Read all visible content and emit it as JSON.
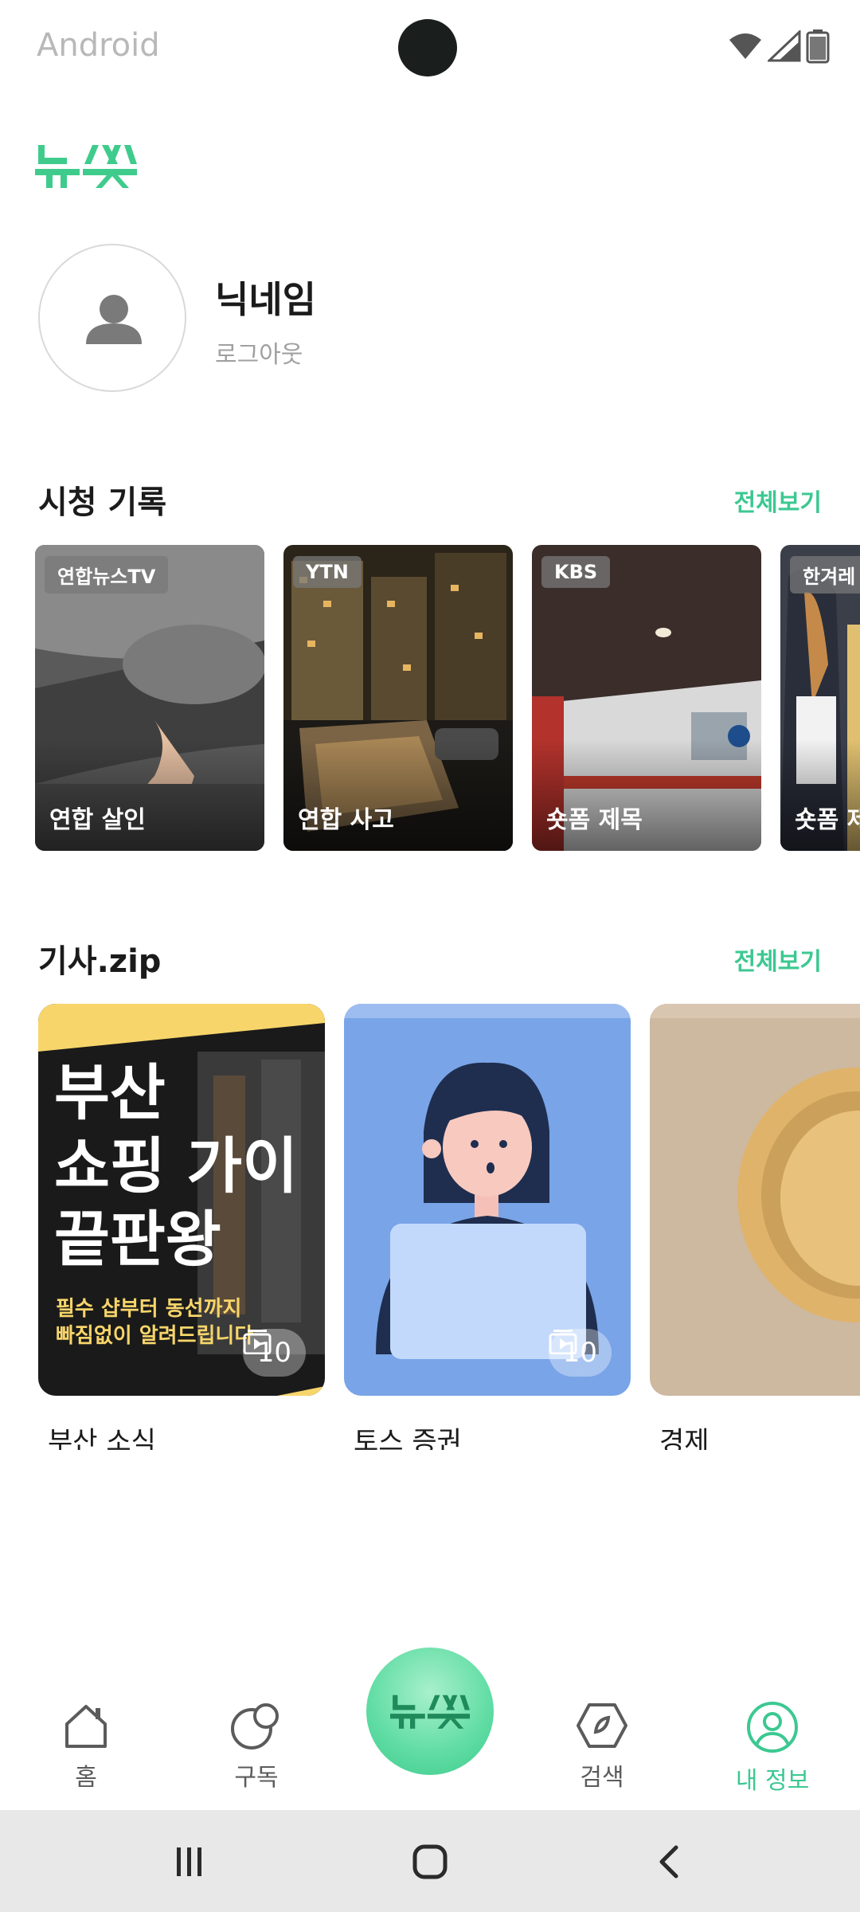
{
  "status_bar": {
    "label": "Android"
  },
  "app": {
    "logo_text": "뉴쓱"
  },
  "profile": {
    "nickname": "닉네임",
    "logout": "로그아웃"
  },
  "watch_history": {
    "title": "시청 기록",
    "see_all": "전체보기",
    "items": [
      {
        "source": "연합뉴스TV",
        "caption": "연합 살인"
      },
      {
        "source": "YTN",
        "caption": "연합 사고"
      },
      {
        "source": "KBS",
        "caption": "숏폼 제목"
      },
      {
        "source": "한겨레",
        "caption": "숏폼 제목"
      }
    ]
  },
  "article_zip": {
    "title": "기사.zip",
    "see_all": "전체보기",
    "items": [
      {
        "label": "부산 소식",
        "count": "10",
        "poster_lines": [
          "부산",
          "쇼핑 가이",
          "끝판왕"
        ],
        "poster_sub": [
          "필수 샵부터 동선까지",
          "빠짐없이 알려드립니다"
        ]
      },
      {
        "label": "토스 증권",
        "count": "10"
      },
      {
        "label": "경제",
        "count": ""
      }
    ]
  },
  "bottom_nav": {
    "items": [
      {
        "label": "홈",
        "icon": "home-icon"
      },
      {
        "label": "구독",
        "icon": "subscribe-icon"
      },
      {
        "label": "뉴쓱",
        "icon": "logo-icon"
      },
      {
        "label": "검색",
        "icon": "compass-icon"
      },
      {
        "label": "내 정보",
        "icon": "profile-icon"
      }
    ],
    "active": "내 정보"
  },
  "colors": {
    "accent": "#3cc891",
    "text": "#1b1b1b",
    "muted": "#a0a0a0"
  }
}
